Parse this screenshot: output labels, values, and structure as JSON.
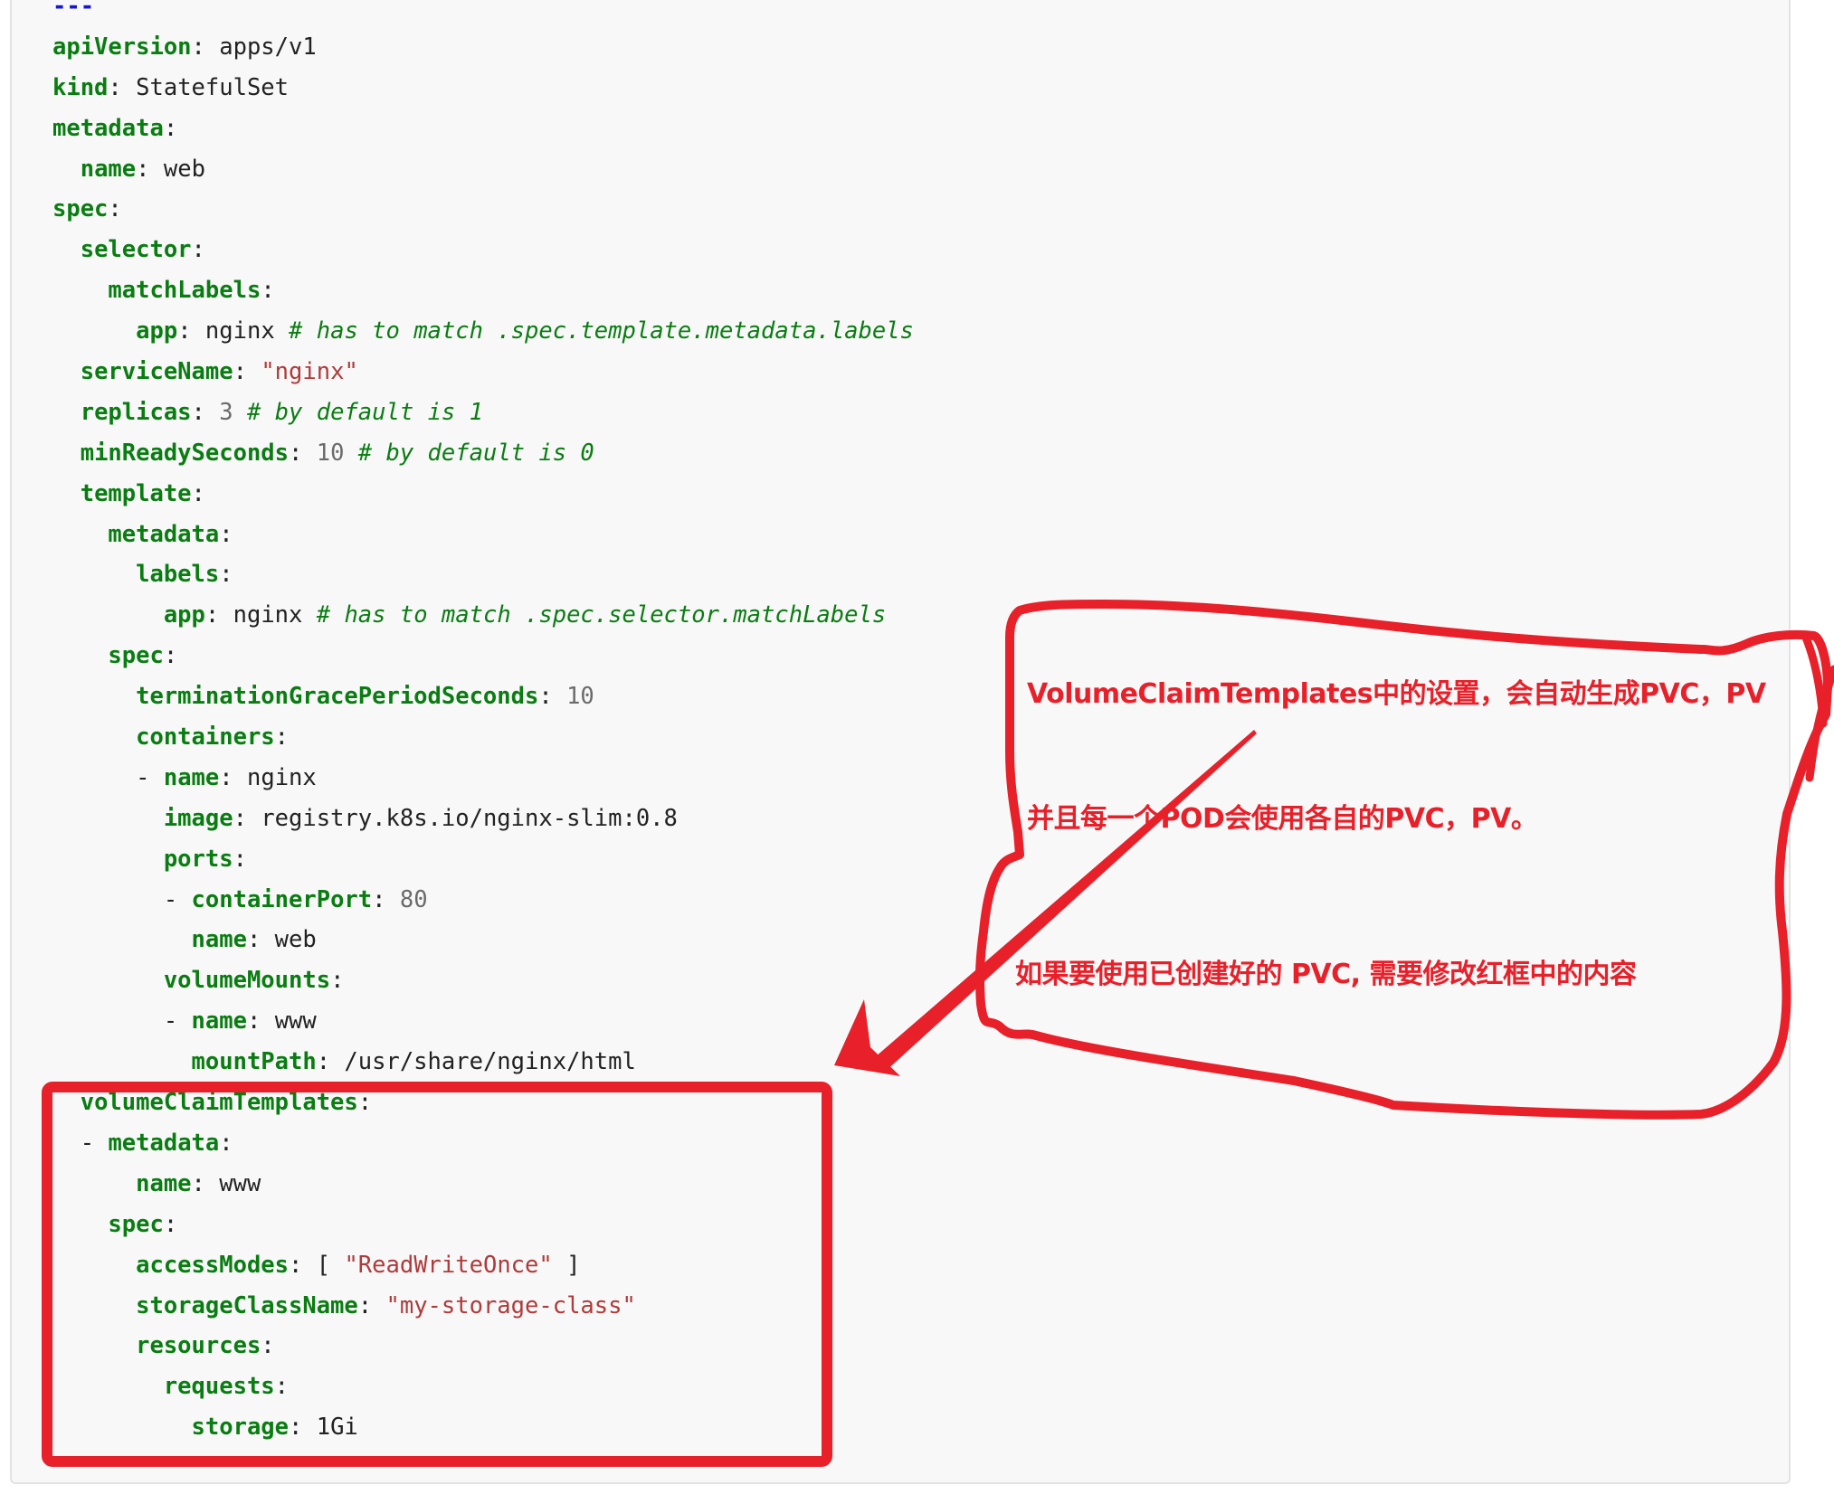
{
  "code": {
    "language": "yaml",
    "lines": [
      [
        {
          "t": "doc",
          "v": "---"
        }
      ],
      [
        {
          "t": "k",
          "v": "apiVersion"
        },
        {
          "t": "p",
          "v": ": "
        },
        {
          "t": "v",
          "v": "apps/v1"
        }
      ],
      [
        {
          "t": "k",
          "v": "kind"
        },
        {
          "t": "p",
          "v": ": "
        },
        {
          "t": "v",
          "v": "StatefulSet"
        }
      ],
      [
        {
          "t": "k",
          "v": "metadata"
        },
        {
          "t": "p",
          "v": ":"
        }
      ],
      [
        {
          "t": "i",
          "v": "  "
        },
        {
          "t": "k",
          "v": "name"
        },
        {
          "t": "p",
          "v": ": "
        },
        {
          "t": "v",
          "v": "web"
        }
      ],
      [
        {
          "t": "k",
          "v": "spec"
        },
        {
          "t": "p",
          "v": ":"
        }
      ],
      [
        {
          "t": "i",
          "v": "  "
        },
        {
          "t": "k",
          "v": "selector"
        },
        {
          "t": "p",
          "v": ":"
        }
      ],
      [
        {
          "t": "i",
          "v": "    "
        },
        {
          "t": "k",
          "v": "matchLabels"
        },
        {
          "t": "p",
          "v": ":"
        }
      ],
      [
        {
          "t": "i",
          "v": "      "
        },
        {
          "t": "k",
          "v": "app"
        },
        {
          "t": "p",
          "v": ": "
        },
        {
          "t": "v",
          "v": "nginx "
        },
        {
          "t": "c",
          "v": "# has to match .spec.template.metadata.labels"
        }
      ],
      [
        {
          "t": "i",
          "v": "  "
        },
        {
          "t": "k",
          "v": "serviceName"
        },
        {
          "t": "p",
          "v": ": "
        },
        {
          "t": "s",
          "v": "\"nginx\""
        }
      ],
      [
        {
          "t": "i",
          "v": "  "
        },
        {
          "t": "k",
          "v": "replicas"
        },
        {
          "t": "p",
          "v": ": "
        },
        {
          "t": "n",
          "v": "3 "
        },
        {
          "t": "c",
          "v": "# by default is 1"
        }
      ],
      [
        {
          "t": "i",
          "v": "  "
        },
        {
          "t": "k",
          "v": "minReadySeconds"
        },
        {
          "t": "p",
          "v": ": "
        },
        {
          "t": "n",
          "v": "10 "
        },
        {
          "t": "c",
          "v": "# by default is 0"
        }
      ],
      [
        {
          "t": "i",
          "v": "  "
        },
        {
          "t": "k",
          "v": "template"
        },
        {
          "t": "p",
          "v": ":"
        }
      ],
      [
        {
          "t": "i",
          "v": "    "
        },
        {
          "t": "k",
          "v": "metadata"
        },
        {
          "t": "p",
          "v": ":"
        }
      ],
      [
        {
          "t": "i",
          "v": "      "
        },
        {
          "t": "k",
          "v": "labels"
        },
        {
          "t": "p",
          "v": ":"
        }
      ],
      [
        {
          "t": "i",
          "v": "        "
        },
        {
          "t": "k",
          "v": "app"
        },
        {
          "t": "p",
          "v": ": "
        },
        {
          "t": "v",
          "v": "nginx "
        },
        {
          "t": "c",
          "v": "# has to match .spec.selector.matchLabels"
        }
      ],
      [
        {
          "t": "i",
          "v": "    "
        },
        {
          "t": "k",
          "v": "spec"
        },
        {
          "t": "p",
          "v": ":"
        }
      ],
      [
        {
          "t": "i",
          "v": "      "
        },
        {
          "t": "k",
          "v": "terminationGracePeriodSeconds"
        },
        {
          "t": "p",
          "v": ": "
        },
        {
          "t": "n",
          "v": "10"
        }
      ],
      [
        {
          "t": "i",
          "v": "      "
        },
        {
          "t": "k",
          "v": "containers"
        },
        {
          "t": "p",
          "v": ":"
        }
      ],
      [
        {
          "t": "i",
          "v": "      "
        },
        {
          "t": "p",
          "v": "- "
        },
        {
          "t": "k",
          "v": "name"
        },
        {
          "t": "p",
          "v": ": "
        },
        {
          "t": "v",
          "v": "nginx"
        }
      ],
      [
        {
          "t": "i",
          "v": "        "
        },
        {
          "t": "k",
          "v": "image"
        },
        {
          "t": "p",
          "v": ": "
        },
        {
          "t": "v",
          "v": "registry.k8s.io/nginx-slim:0.8"
        }
      ],
      [
        {
          "t": "i",
          "v": "        "
        },
        {
          "t": "k",
          "v": "ports"
        },
        {
          "t": "p",
          "v": ":"
        }
      ],
      [
        {
          "t": "i",
          "v": "        "
        },
        {
          "t": "p",
          "v": "- "
        },
        {
          "t": "k",
          "v": "containerPort"
        },
        {
          "t": "p",
          "v": ": "
        },
        {
          "t": "n",
          "v": "80"
        }
      ],
      [
        {
          "t": "i",
          "v": "          "
        },
        {
          "t": "k",
          "v": "name"
        },
        {
          "t": "p",
          "v": ": "
        },
        {
          "t": "v",
          "v": "web"
        }
      ],
      [
        {
          "t": "i",
          "v": "        "
        },
        {
          "t": "k",
          "v": "volumeMounts"
        },
        {
          "t": "p",
          "v": ":"
        }
      ],
      [
        {
          "t": "i",
          "v": "        "
        },
        {
          "t": "p",
          "v": "- "
        },
        {
          "t": "k",
          "v": "name"
        },
        {
          "t": "p",
          "v": ": "
        },
        {
          "t": "v",
          "v": "www"
        }
      ],
      [
        {
          "t": "i",
          "v": "          "
        },
        {
          "t": "k",
          "v": "mountPath"
        },
        {
          "t": "p",
          "v": ": "
        },
        {
          "t": "v",
          "v": "/usr/share/nginx/html"
        }
      ],
      [
        {
          "t": "i",
          "v": "  "
        },
        {
          "t": "k",
          "v": "volumeClaimTemplates"
        },
        {
          "t": "p",
          "v": ":"
        }
      ],
      [
        {
          "t": "i",
          "v": "  "
        },
        {
          "t": "p",
          "v": "- "
        },
        {
          "t": "k",
          "v": "metadata"
        },
        {
          "t": "p",
          "v": ":"
        }
      ],
      [
        {
          "t": "i",
          "v": "      "
        },
        {
          "t": "k",
          "v": "name"
        },
        {
          "t": "p",
          "v": ": "
        },
        {
          "t": "v",
          "v": "www"
        }
      ],
      [
        {
          "t": "i",
          "v": "    "
        },
        {
          "t": "k",
          "v": "spec"
        },
        {
          "t": "p",
          "v": ":"
        }
      ],
      [
        {
          "t": "i",
          "v": "      "
        },
        {
          "t": "k",
          "v": "accessModes"
        },
        {
          "t": "p",
          "v": ": [ "
        },
        {
          "t": "s",
          "v": "\"ReadWriteOnce\""
        },
        {
          "t": "p",
          "v": " ]"
        }
      ],
      [
        {
          "t": "i",
          "v": "      "
        },
        {
          "t": "k",
          "v": "storageClassName"
        },
        {
          "t": "p",
          "v": ": "
        },
        {
          "t": "s",
          "v": "\"my-storage-class\""
        }
      ],
      [
        {
          "t": "i",
          "v": "      "
        },
        {
          "t": "k",
          "v": "resources"
        },
        {
          "t": "p",
          "v": ":"
        }
      ],
      [
        {
          "t": "i",
          "v": "        "
        },
        {
          "t": "k",
          "v": "requests"
        },
        {
          "t": "p",
          "v": ":"
        }
      ],
      [
        {
          "t": "i",
          "v": "          "
        },
        {
          "t": "k",
          "v": "storage"
        },
        {
          "t": "p",
          "v": ": "
        },
        {
          "t": "v",
          "v": "1Gi"
        }
      ]
    ]
  },
  "annotation": {
    "color": "#e8202a",
    "note_line_1": "VolumeClaimTemplates中的设置，会自动生成PVC，PV",
    "note_line_2": "并且每一个POD会使用各自的PVC，PV。",
    "note_line_3": "如果要使用已创建好的 PVC, 需要修改红框中的内容",
    "highlighted_section": "volumeClaimTemplates"
  }
}
